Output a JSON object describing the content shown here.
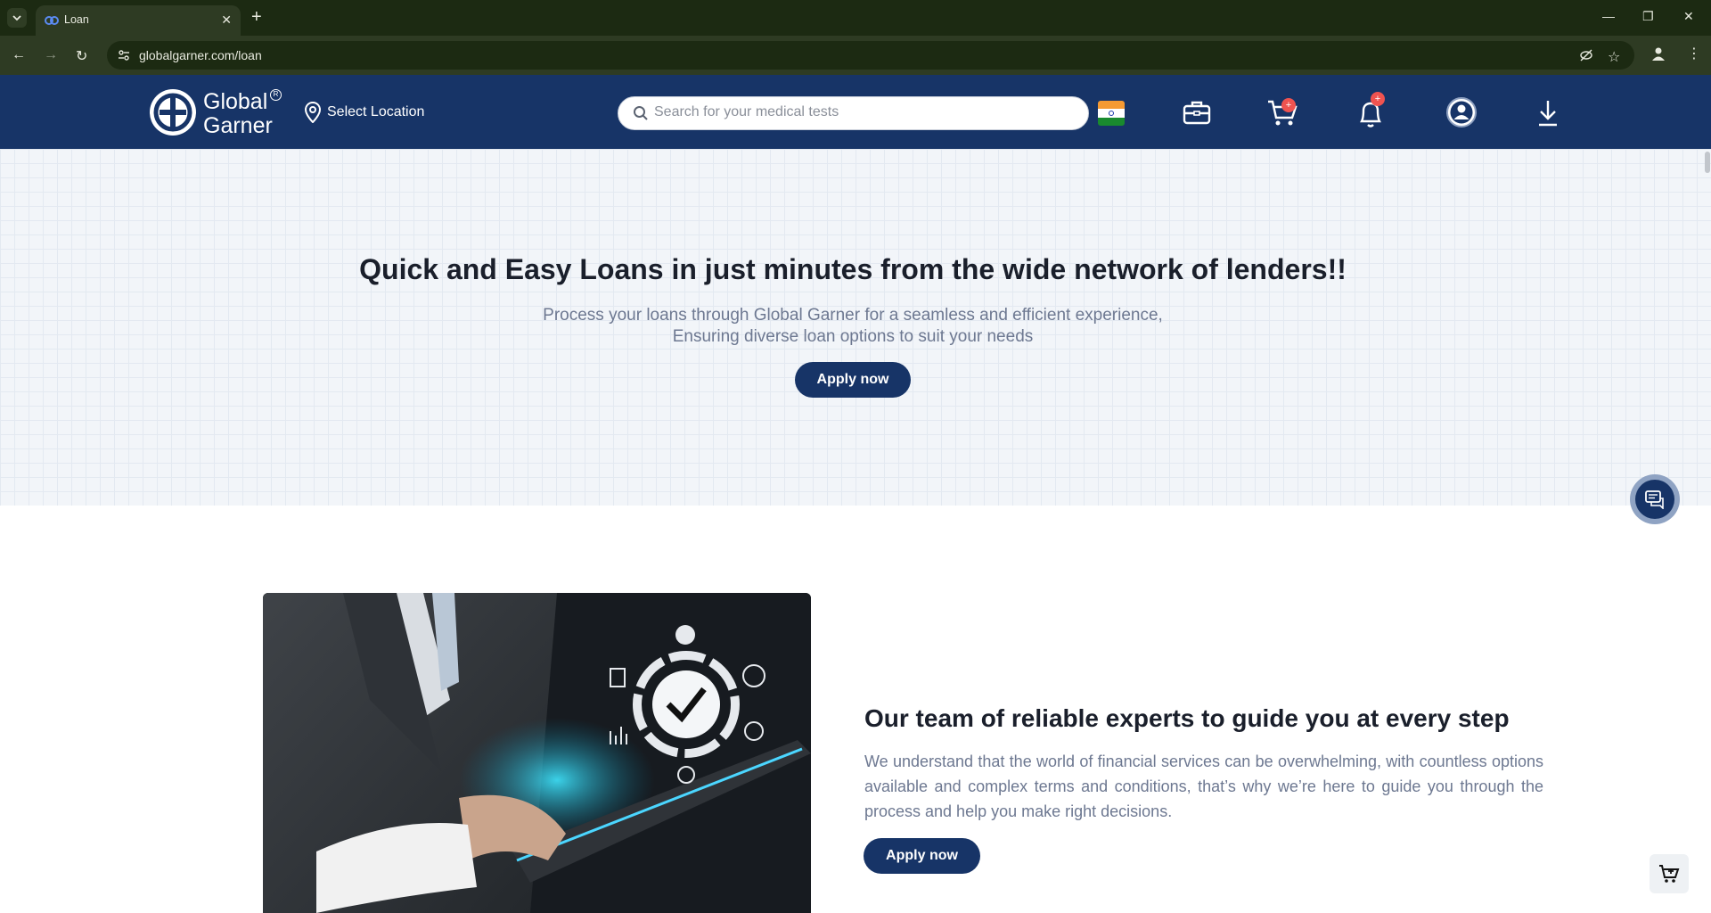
{
  "browser": {
    "tab_title": "Loan",
    "url": "globalgarner.com/loan",
    "new_tab": "+",
    "tab_close": "✕"
  },
  "header": {
    "brand_line1": "Global",
    "brand_line2": "Garner",
    "registered": "R",
    "location_label": "Select Location",
    "search_placeholder": "Search for your medical tests",
    "cart_badge": "+",
    "notification_badge": "+"
  },
  "hero": {
    "title": "Quick and Easy Loans in just minutes from the wide network of lenders!!",
    "subtitle_line1": "Process your loans through Global Garner for a seamless and efficient experience,",
    "subtitle_line2": "Ensuring diverse loan options to suit your needs",
    "cta": "Apply now"
  },
  "section2": {
    "title": "Our team of reliable experts to guide you at every step",
    "body": "We understand that the world of financial services can be overwhelming, with countless options available and complex terms and conditions, that’s why we’re here to guide you through the process and help you make right decisions.",
    "cta": "Apply now"
  },
  "colors": {
    "brand_navy": "#173467",
    "browser_frame": "#1c2a12",
    "badge_red": "#ef5350",
    "hero_bg": "#f2f5f9"
  },
  "icons": [
    "chevron-down-icon",
    "globe-favicon-icon",
    "back-icon",
    "forward-icon",
    "reload-icon",
    "site-info-icon",
    "eye-off-icon",
    "star-icon",
    "profile-icon",
    "kebab-menu-icon",
    "location-pin-icon",
    "search-icon",
    "india-flag-icon",
    "briefcase-icon",
    "cart-icon",
    "bell-icon",
    "user-circle-icon",
    "download-icon",
    "chat-icon",
    "cart-add-icon"
  ]
}
